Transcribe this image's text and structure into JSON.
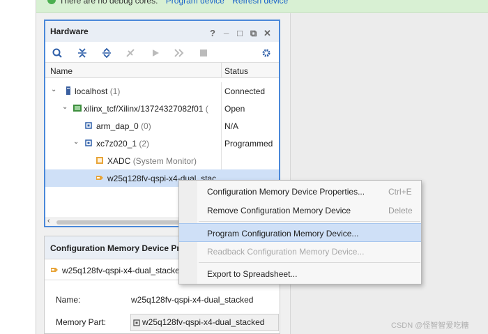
{
  "banner": {
    "message": "There are no debug cores.",
    "link_program": "Program device",
    "link_refresh": "Refresh device"
  },
  "hardware": {
    "title": "Hardware",
    "controls": {
      "help": "?",
      "minimize": "_",
      "maximize": "□",
      "float": "⧉",
      "close": "✕"
    },
    "columns": {
      "name": "Name",
      "status": "Status"
    },
    "rows": [
      {
        "name": "localhost",
        "suffix": "(1)",
        "status": "Connected"
      },
      {
        "name": "xilinx_tcf/Xilinx/13724327082f01",
        "suffix": "(",
        "status": "Open"
      },
      {
        "name": "arm_dap_0",
        "suffix": "(0)",
        "status": "N/A"
      },
      {
        "name": "xc7z020_1",
        "suffix": "(2)",
        "status": "Programmed"
      },
      {
        "name": "XADC",
        "suffix": "(System Monitor)",
        "status": ""
      },
      {
        "name": "w25q128fv-qspi-x4-dual_stac",
        "suffix": "",
        "status": ""
      }
    ]
  },
  "properties": {
    "title": "Configuration Memory Device Pro",
    "item": "w25q128fv-qspi-x4-dual_stacked",
    "fields": [
      {
        "label": "Name:",
        "value": "w25q128fv-qspi-x4-dual_stacked"
      },
      {
        "label": "Memory Part:",
        "value": "w25q128fv-qspi-x4-dual_stacked"
      }
    ]
  },
  "context_menu": {
    "items": [
      {
        "label": "Configuration Memory Device Properties...",
        "shortcut": "Ctrl+E",
        "enabled": true,
        "highlighted": false
      },
      {
        "label": "Remove Configuration Memory Device",
        "shortcut": "Delete",
        "enabled": true,
        "highlighted": false
      },
      {
        "label": "Program Configuration Memory Device...",
        "shortcut": "",
        "enabled": true,
        "highlighted": true
      },
      {
        "label": "Readback Configuration Memory Device...",
        "shortcut": "",
        "enabled": false,
        "highlighted": false
      },
      {
        "label": "Export to Spreadsheet...",
        "shortcut": "",
        "enabled": true,
        "highlighted": false
      }
    ]
  },
  "watermark": "CSDN @怪智智爱吃糖",
  "colors": {
    "accent": "#4a88d9",
    "selection": "#cfe0f7",
    "banner": "#d8f0d3",
    "link": "#1a63c9"
  }
}
